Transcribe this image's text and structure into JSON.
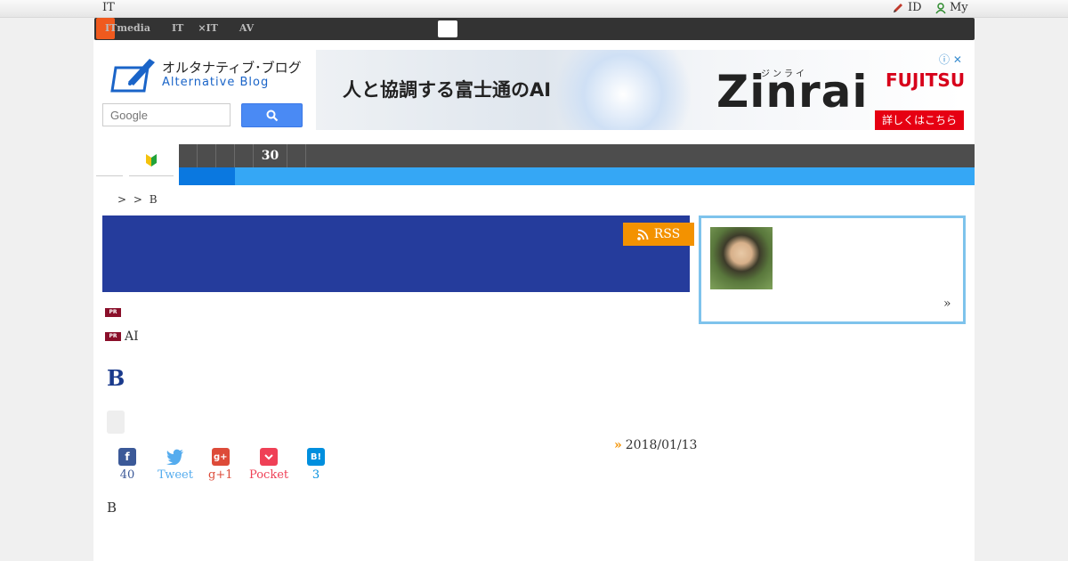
{
  "topbar": {
    "site_label": "IT",
    "login_label": "ID",
    "my_label": "My"
  },
  "network_bar": {
    "links": [
      "ITmedia",
      "",
      "",
      "IT",
      "",
      "×IT",
      "",
      "",
      "AV",
      ""
    ],
    "active_label": ""
  },
  "header": {
    "logo_jp": "オルタナティブ･ブログ",
    "logo_en": "Alternative Blog",
    "search_placeholder": "Google"
  },
  "ad": {
    "headline": "人と協調する富士通のAI",
    "brand": "Zinrai",
    "brand_kana": "ジンライ",
    "company": "FUJITSU",
    "cta": "詳しくはこちら",
    "choices": "ⓘ ✕"
  },
  "nav": {
    "beginner_icon": "beginner-mark",
    "count_label": "30"
  },
  "breadcrumb": "> > B",
  "rss_label": "RSS",
  "pr_items": [
    {
      "badge": "PR",
      "text": ""
    },
    {
      "badge": "PR",
      "text": "AI"
    }
  ],
  "entry": {
    "title": "B",
    "date": "2018/01/13",
    "body": "B"
  },
  "share": [
    {
      "name": "facebook",
      "count": "40",
      "color": "#3b5998"
    },
    {
      "name": "twitter",
      "label": "Tweet",
      "color": "#55acee"
    },
    {
      "name": "gplus",
      "label": "g+1",
      "color": "#dd4b39"
    },
    {
      "name": "pocket",
      "label": "Pocket",
      "color": "#ef4056"
    },
    {
      "name": "hatena",
      "count": "3",
      "color": "#008fde"
    }
  ],
  "profile": {
    "more_label": "»"
  },
  "colors": {
    "banner": "#253c9c",
    "accent_orange": "#f39200",
    "nav_blue": "#35a7f5",
    "title_blue": "#1a3a8c"
  }
}
